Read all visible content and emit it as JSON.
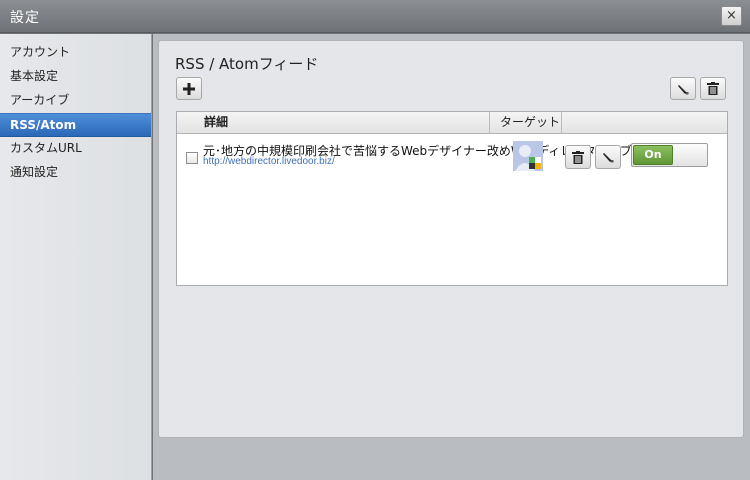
{
  "window": {
    "title": "設定",
    "close_label": "×"
  },
  "sidebar": {
    "items": [
      {
        "label": "アカウント",
        "active": false
      },
      {
        "label": "基本設定",
        "active": false
      },
      {
        "label": "アーカイブ",
        "active": false
      },
      {
        "label": "RSS/Atom",
        "active": true
      },
      {
        "label": "カスタムURL",
        "active": false
      },
      {
        "label": "通知設定",
        "active": false
      }
    ]
  },
  "panel": {
    "title": "RSS / Atomフィード",
    "table": {
      "columns": [
        "詳細",
        "ターゲット"
      ],
      "rows": [
        {
          "title": "元･地方の中規模印刷会社で苦悩するWebデザイナー改めWebディレクターのブロ",
          "url": "http://webdirector.livedoor.biz/",
          "status": "On"
        }
      ]
    }
  },
  "colors": {
    "accent": "#2b68b8",
    "toggle_on": "#6aa33f"
  },
  "icons": [
    "plus-icon",
    "pencil-icon",
    "trash-icon",
    "close-icon"
  ]
}
